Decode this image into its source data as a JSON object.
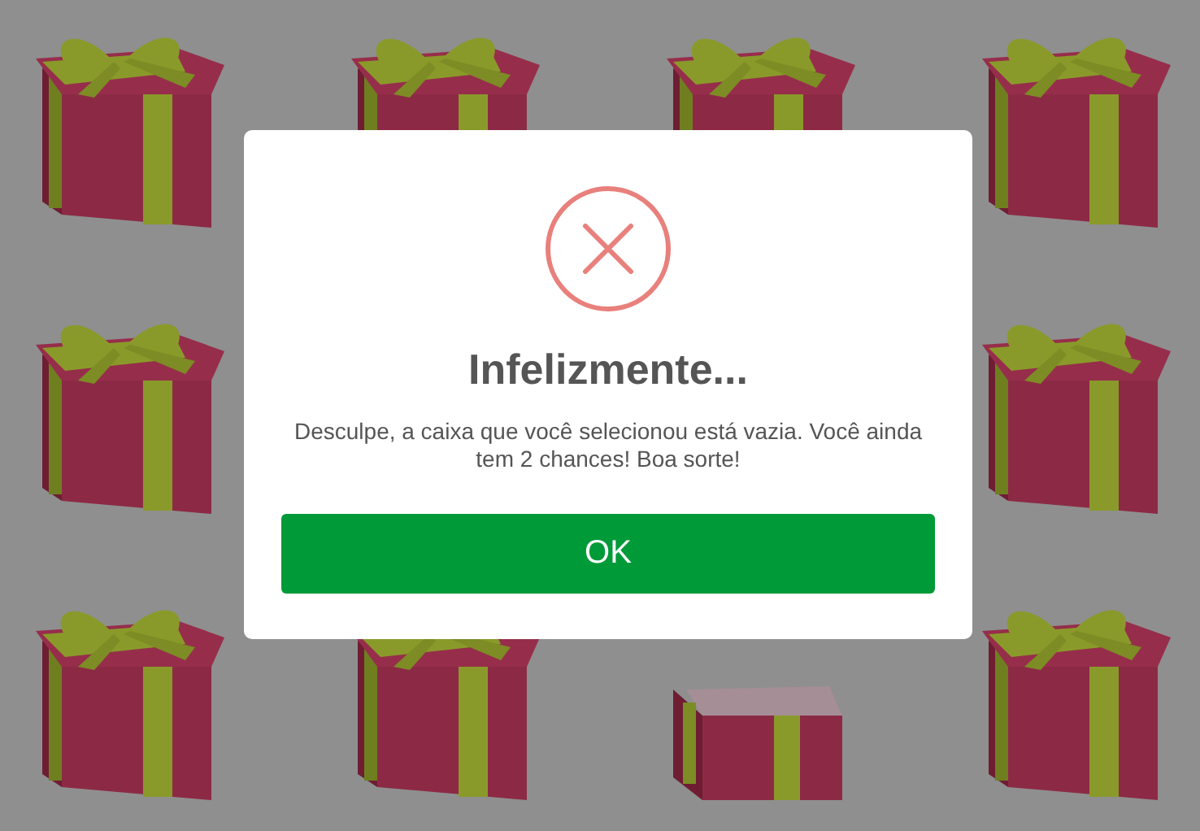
{
  "boxes": [
    {
      "opened": false
    },
    {
      "opened": false
    },
    {
      "opened": false
    },
    {
      "opened": false
    },
    {
      "opened": false
    },
    {
      "opened": false
    },
    {
      "opened": false
    },
    {
      "opened": false
    },
    {
      "opened": true
    },
    {
      "opened": false
    }
  ],
  "dialog": {
    "title": "Infelizmente...",
    "message": "Desculpe, a caixa que você selecionou está vazia. Você ainda tem 2 chances! Boa sorte!",
    "button": "OK"
  }
}
